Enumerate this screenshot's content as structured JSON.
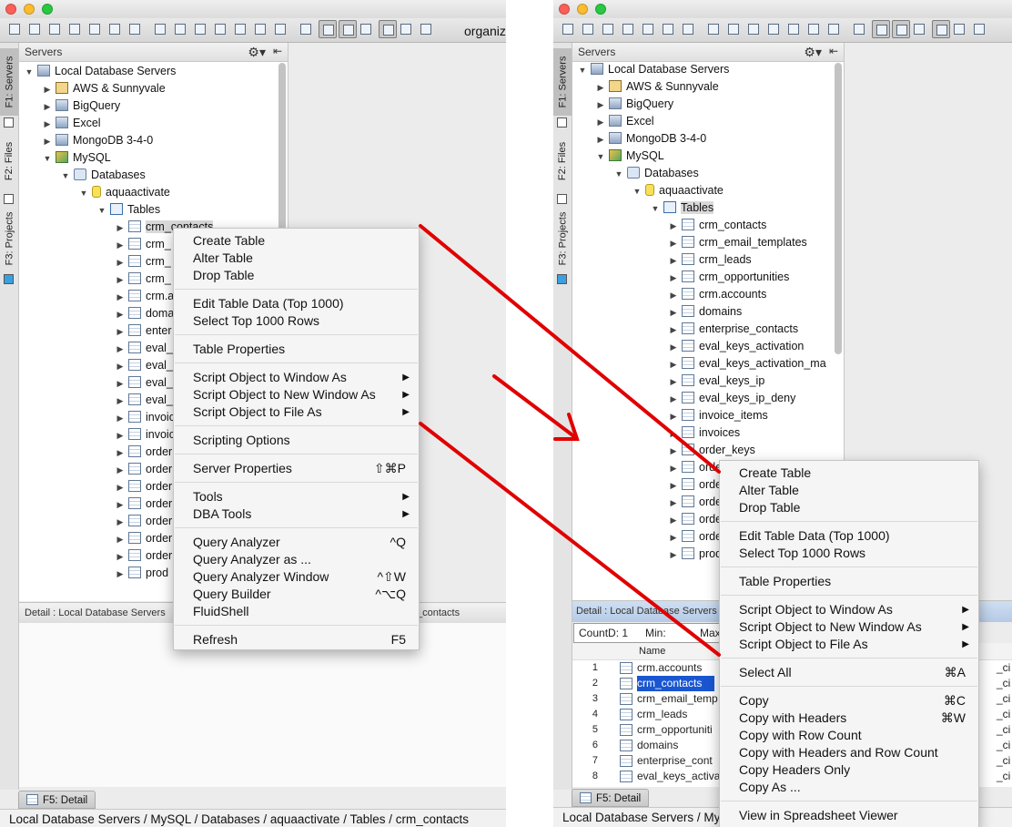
{
  "left": {
    "toolbar_text": "organiz",
    "sidebar_tabs": [
      "F1: Servers",
      "F2: Files",
      "F3: Projects"
    ],
    "panel_title": "Servers",
    "tree": [
      {
        "label": "Local Database Servers",
        "icon": "server-icon",
        "depth": 0,
        "toggle": "expanded"
      },
      {
        "label": "AWS & Sunnyvale",
        "icon": "folder-icon",
        "depth": 1,
        "toggle": "collapsed"
      },
      {
        "label": "BigQuery",
        "icon": "server-icon",
        "depth": 1,
        "toggle": "collapsed"
      },
      {
        "label": "Excel",
        "icon": "server-icon",
        "depth": 1,
        "toggle": "collapsed"
      },
      {
        "label": "MongoDB 3-4-0",
        "icon": "server-icon",
        "depth": 1,
        "toggle": "collapsed"
      },
      {
        "label": "MySQL",
        "icon": "mysql-icon",
        "depth": 1,
        "toggle": "expanded"
      },
      {
        "label": "Databases",
        "icon": "databases-icon",
        "depth": 2,
        "toggle": "expanded"
      },
      {
        "label": "aquaactivate",
        "icon": "database-icon",
        "depth": 3,
        "toggle": "expanded"
      },
      {
        "label": "Tables",
        "icon": "tables-folder-icon",
        "depth": 4,
        "toggle": "expanded"
      },
      {
        "label": "crm_contacts",
        "icon": "table-icon",
        "depth": 5,
        "toggle": "collapsed",
        "state": "highlight"
      },
      {
        "label": "crm_",
        "icon": "table-icon",
        "depth": 5,
        "toggle": "collapsed"
      },
      {
        "label": "crm_",
        "icon": "table-icon",
        "depth": 5,
        "toggle": "collapsed"
      },
      {
        "label": "crm_",
        "icon": "table-icon",
        "depth": 5,
        "toggle": "collapsed"
      },
      {
        "label": "crm.a",
        "icon": "table-icon",
        "depth": 5,
        "toggle": "collapsed"
      },
      {
        "label": "doma",
        "icon": "table-icon",
        "depth": 5,
        "toggle": "collapsed"
      },
      {
        "label": "enter",
        "icon": "table-icon",
        "depth": 5,
        "toggle": "collapsed"
      },
      {
        "label": "eval_",
        "icon": "table-icon",
        "depth": 5,
        "toggle": "collapsed"
      },
      {
        "label": "eval_",
        "icon": "table-icon",
        "depth": 5,
        "toggle": "collapsed"
      },
      {
        "label": "eval_",
        "icon": "table-icon",
        "depth": 5,
        "toggle": "collapsed"
      },
      {
        "label": "eval_",
        "icon": "table-icon",
        "depth": 5,
        "toggle": "collapsed"
      },
      {
        "label": "invoic",
        "icon": "table-icon",
        "depth": 5,
        "toggle": "collapsed"
      },
      {
        "label": "invoic",
        "icon": "table-icon",
        "depth": 5,
        "toggle": "collapsed"
      },
      {
        "label": "order",
        "icon": "table-icon",
        "depth": 5,
        "toggle": "collapsed"
      },
      {
        "label": "order",
        "icon": "table-icon",
        "depth": 5,
        "toggle": "collapsed"
      },
      {
        "label": "order",
        "icon": "table-icon",
        "depth": 5,
        "toggle": "collapsed"
      },
      {
        "label": "order",
        "icon": "table-icon",
        "depth": 5,
        "toggle": "collapsed"
      },
      {
        "label": "order",
        "icon": "table-icon",
        "depth": 5,
        "toggle": "collapsed"
      },
      {
        "label": "order",
        "icon": "table-icon",
        "depth": 5,
        "toggle": "collapsed"
      },
      {
        "label": "order",
        "icon": "table-icon",
        "depth": 5,
        "toggle": "collapsed"
      },
      {
        "label": "prod",
        "icon": "table-icon",
        "depth": 5,
        "toggle": "collapsed"
      }
    ],
    "detail_bar": "Detail : Local Database Servers",
    "detail_bar_right": "_contacts",
    "bottom_tab": "F5: Detail",
    "status": "Local Database Servers / MySQL / Databases / aquaactivate / Tables / crm_contacts",
    "menu": [
      {
        "label": "Create Table"
      },
      {
        "label": "Alter Table"
      },
      {
        "label": "Drop Table",
        "sep_after": true
      },
      {
        "label": "Edit Table Data (Top 1000)"
      },
      {
        "label": "Select Top 1000 Rows",
        "sep_after": true
      },
      {
        "label": "Table Properties",
        "sep_after": true
      },
      {
        "label": "Script Object to Window As",
        "submenu": true
      },
      {
        "label": "Script Object to New Window As",
        "submenu": true
      },
      {
        "label": "Script Object to File As",
        "submenu": true,
        "sep_after": true
      },
      {
        "label": "Scripting Options",
        "sep_after": true
      },
      {
        "label": "Server Properties",
        "shortcut": "⇧⌘P",
        "sep_after": true
      },
      {
        "label": "Tools",
        "submenu": true
      },
      {
        "label": "DBA Tools",
        "submenu": true,
        "sep_after": true
      },
      {
        "label": "Query Analyzer",
        "shortcut": "^Q"
      },
      {
        "label": "Query Analyzer as ..."
      },
      {
        "label": "Query Analyzer Window",
        "shortcut": "^⇧W"
      },
      {
        "label": "Query Builder",
        "shortcut": "^⌥Q"
      },
      {
        "label": "FluidShell",
        "sep_after": true
      },
      {
        "label": "Refresh",
        "shortcut": "F5"
      }
    ]
  },
  "right": {
    "sidebar_tabs": [
      "F1: Servers",
      "F2: Files",
      "F3: Projects"
    ],
    "panel_title": "Servers",
    "tree": [
      {
        "label": "Local Database Servers",
        "icon": "server-icon",
        "depth": 0,
        "toggle": "expanded"
      },
      {
        "label": "AWS & Sunnyvale",
        "icon": "folder-icon",
        "depth": 1,
        "toggle": "collapsed"
      },
      {
        "label": "BigQuery",
        "icon": "server-icon",
        "depth": 1,
        "toggle": "collapsed"
      },
      {
        "label": "Excel",
        "icon": "server-icon",
        "depth": 1,
        "toggle": "collapsed"
      },
      {
        "label": "MongoDB 3-4-0",
        "icon": "server-icon",
        "depth": 1,
        "toggle": "collapsed"
      },
      {
        "label": "MySQL",
        "icon": "mysql-icon",
        "depth": 1,
        "toggle": "expanded"
      },
      {
        "label": "Databases",
        "icon": "databases-icon",
        "depth": 2,
        "toggle": "expanded"
      },
      {
        "label": "aquaactivate",
        "icon": "database-icon",
        "depth": 3,
        "toggle": "expanded"
      },
      {
        "label": "Tables",
        "icon": "tables-folder-icon",
        "depth": 4,
        "toggle": "expanded",
        "state": "highlight"
      },
      {
        "label": "crm_contacts",
        "icon": "table-icon",
        "depth": 5,
        "toggle": "collapsed"
      },
      {
        "label": "crm_email_templates",
        "icon": "table-icon",
        "depth": 5,
        "toggle": "collapsed"
      },
      {
        "label": "crm_leads",
        "icon": "table-icon",
        "depth": 5,
        "toggle": "collapsed"
      },
      {
        "label": "crm_opportunities",
        "icon": "table-icon",
        "depth": 5,
        "toggle": "collapsed"
      },
      {
        "label": "crm.accounts",
        "icon": "table-icon",
        "depth": 5,
        "toggle": "collapsed"
      },
      {
        "label": "domains",
        "icon": "table-icon",
        "depth": 5,
        "toggle": "collapsed"
      },
      {
        "label": "enterprise_contacts",
        "icon": "table-icon",
        "depth": 5,
        "toggle": "collapsed"
      },
      {
        "label": "eval_keys_activation",
        "icon": "table-icon",
        "depth": 5,
        "toggle": "collapsed"
      },
      {
        "label": "eval_keys_activation_ma",
        "icon": "table-icon",
        "depth": 5,
        "toggle": "collapsed"
      },
      {
        "label": "eval_keys_ip",
        "icon": "table-icon",
        "depth": 5,
        "toggle": "collapsed"
      },
      {
        "label": "eval_keys_ip_deny",
        "icon": "table-icon",
        "depth": 5,
        "toggle": "collapsed"
      },
      {
        "label": "invoice_items",
        "icon": "table-icon",
        "depth": 5,
        "toggle": "collapsed"
      },
      {
        "label": "invoices",
        "icon": "table-icon",
        "depth": 5,
        "toggle": "collapsed"
      },
      {
        "label": "order_keys",
        "icon": "table-icon",
        "depth": 5,
        "toggle": "collapsed"
      },
      {
        "label": "orde",
        "icon": "table-icon",
        "depth": 5,
        "toggle": "collapsed"
      },
      {
        "label": "orde",
        "icon": "table-icon",
        "depth": 5,
        "toggle": "collapsed"
      },
      {
        "label": "orde",
        "icon": "table-icon",
        "depth": 5,
        "toggle": "collapsed"
      },
      {
        "label": "orde",
        "icon": "table-icon",
        "depth": 5,
        "toggle": "collapsed"
      },
      {
        "label": "orde",
        "icon": "table-icon",
        "depth": 5,
        "toggle": "collapsed"
      },
      {
        "label": "prod",
        "icon": "table-icon",
        "depth": 5,
        "toggle": "collapsed"
      }
    ],
    "detail_bar": "Detail : Local Database Servers",
    "count_bar": {
      "count": "CountD: 1",
      "min": "Min:",
      "max": "Max:"
    },
    "grid_header": "Name",
    "grid_rows": [
      {
        "n": "1",
        "name": "crm.accounts",
        "suffix": "_ci"
      },
      {
        "n": "2",
        "name": "crm_contacts",
        "suffix": "_ci",
        "selected": true
      },
      {
        "n": "3",
        "name": "crm_email_temp",
        "suffix": "_ci"
      },
      {
        "n": "4",
        "name": "crm_leads",
        "suffix": "_ci"
      },
      {
        "n": "5",
        "name": "crm_opportuniti",
        "suffix": "_ci"
      },
      {
        "n": "6",
        "name": "domains",
        "suffix": "_ci"
      },
      {
        "n": "7",
        "name": "enterprise_cont",
        "suffix": "_ci"
      },
      {
        "n": "8",
        "name": "eval_keys_activa",
        "suffix": "_ci"
      }
    ],
    "bottom_tab": "F5: Detail",
    "status": "Local Database Servers / My",
    "menu": [
      {
        "label": "Create Table"
      },
      {
        "label": "Alter Table"
      },
      {
        "label": "Drop Table",
        "sep_after": true
      },
      {
        "label": "Edit Table Data (Top 1000)"
      },
      {
        "label": "Select Top 1000 Rows",
        "sep_after": true
      },
      {
        "label": "Table Properties",
        "sep_after": true
      },
      {
        "label": "Script Object to Window As",
        "submenu": true
      },
      {
        "label": "Script Object to New Window As",
        "submenu": true
      },
      {
        "label": "Script Object to File As",
        "submenu": true,
        "sep_after": true
      },
      {
        "label": "Select All",
        "shortcut": "⌘A",
        "sep_after": true
      },
      {
        "label": "Copy",
        "shortcut": "⌘C"
      },
      {
        "label": "Copy with Headers",
        "shortcut": "⌘W"
      },
      {
        "label": "Copy with Row Count"
      },
      {
        "label": "Copy with Headers and Row Count"
      },
      {
        "label": "Copy Headers Only"
      },
      {
        "label": "Copy As ...",
        "sep_after": true
      },
      {
        "label": "View in Spreadsheet Viewer"
      }
    ]
  },
  "colors": {
    "arrow": "#e00000",
    "selection": "#1a56d0",
    "highlight": "#d9d9d9"
  }
}
